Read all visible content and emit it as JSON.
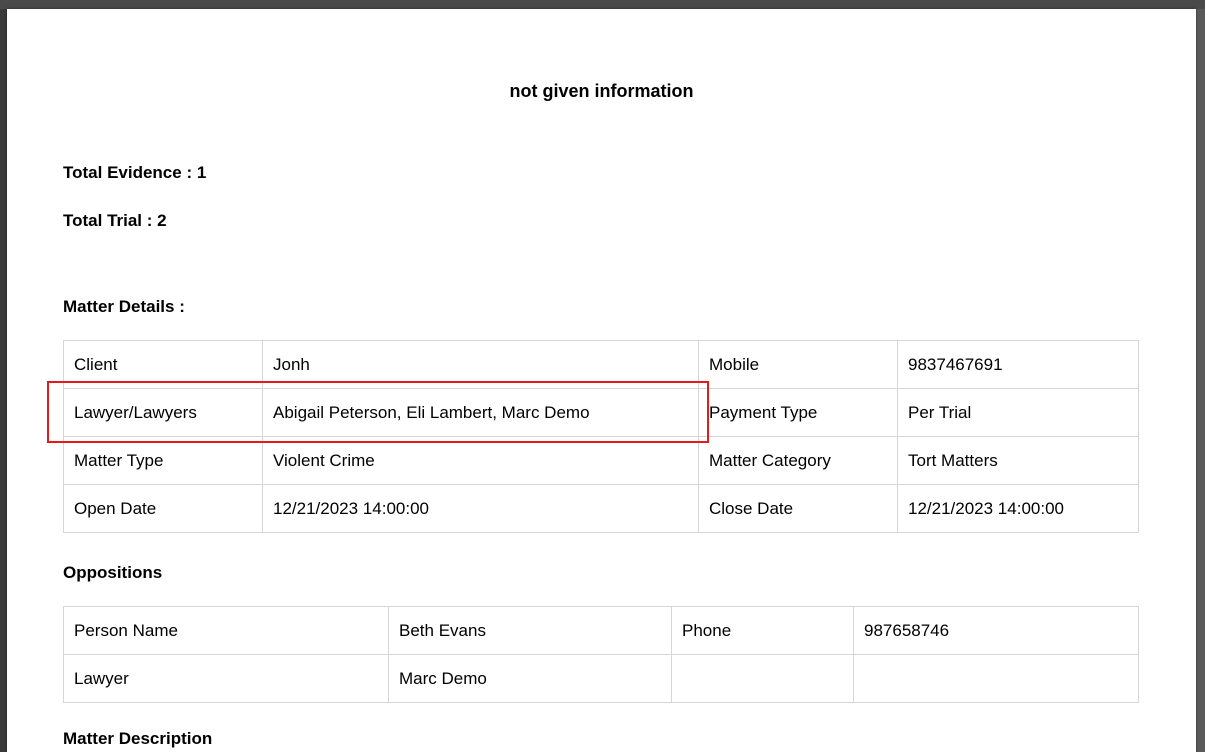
{
  "document": {
    "title": "not given information",
    "total_evidence_label": "Total Evidence : 1",
    "total_trial_label": "Total Trial : 2"
  },
  "matter_details": {
    "heading": "Matter Details :",
    "rows": [
      [
        "Client",
        "Jonh",
        "Mobile",
        "9837467691"
      ],
      [
        "Lawyer/Lawyers",
        "Abigail Peterson, Eli Lambert, Marc Demo",
        "Payment Type",
        "Per Trial"
      ],
      [
        "Matter Type",
        "Violent Crime",
        "Matter Category",
        "Tort Matters"
      ],
      [
        "Open Date",
        "12/21/2023 14:00:00",
        "Close Date",
        "12/21/2023 14:00:00"
      ]
    ]
  },
  "oppositions": {
    "heading": "Oppositions",
    "rows": [
      [
        "Person Name",
        "Beth Evans",
        "Phone",
        "987658746"
      ],
      [
        "Lawyer",
        "Marc Demo",
        "",
        ""
      ]
    ]
  },
  "matter_description": {
    "heading": "Matter Description"
  },
  "colors": {
    "highlight": "#e41b1b",
    "table_border": "#d6d6d6",
    "viewer_background": "#3a3a3a"
  }
}
